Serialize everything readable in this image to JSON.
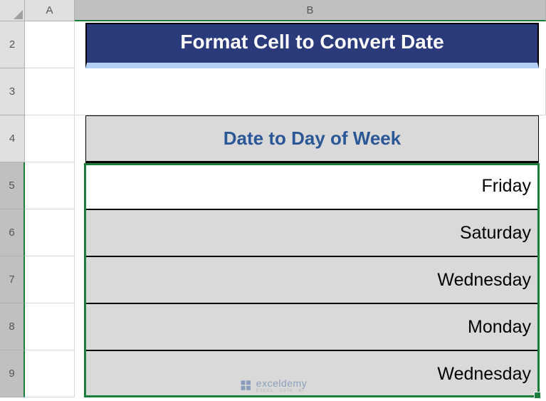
{
  "columns": {
    "a": "A",
    "b": "B"
  },
  "rows": {
    "r2": "2",
    "r3": "3",
    "r4": "4",
    "r5": "5",
    "r6": "6",
    "r7": "7",
    "r8": "8",
    "r9": "9"
  },
  "title": "Format Cell to Convert Date",
  "header": "Date to Day of Week",
  "data": {
    "r5": "Friday",
    "r6": "Saturday",
    "r7": "Wednesday",
    "r8": "Monday",
    "r9": "Wednesday"
  },
  "watermark": {
    "name": "exceldemy",
    "tag": "EXCEL · DATA · BI"
  },
  "colors": {
    "titleBg": "#2b3a7a",
    "titleUnderline": "#b5cef5",
    "headerText": "#2b5797",
    "cellFill": "#d9d9d9",
    "selection": "#1a7e3a"
  }
}
